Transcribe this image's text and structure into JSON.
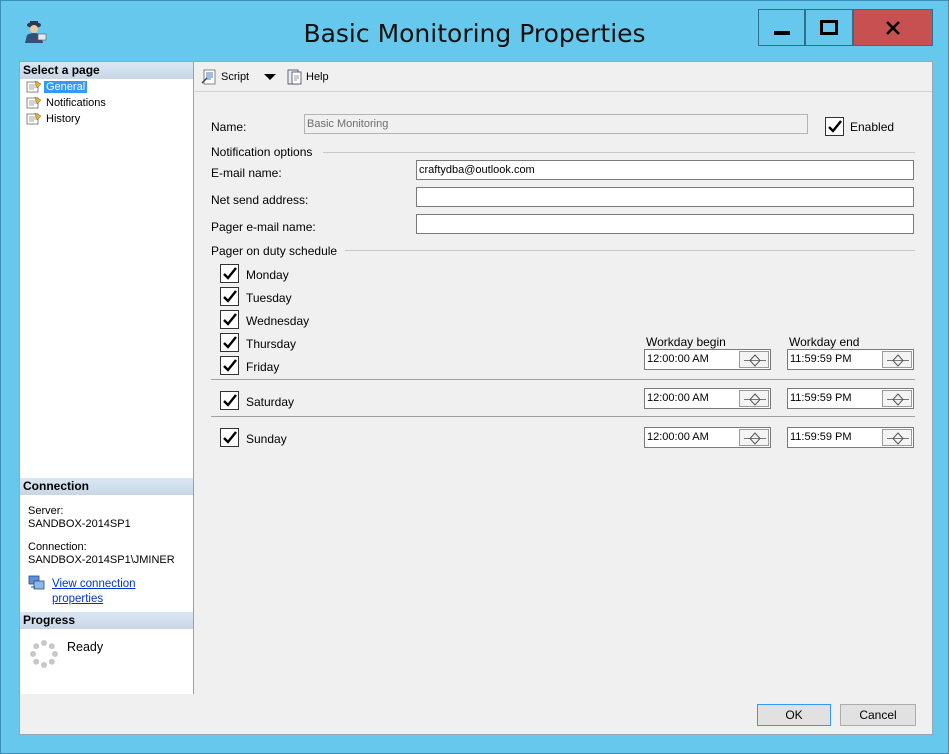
{
  "window": {
    "title": "Basic Monitoring Properties"
  },
  "left": {
    "select_page_header": "Select a page",
    "pages": [
      {
        "label": "General",
        "selected": true
      },
      {
        "label": "Notifications",
        "selected": false
      },
      {
        "label": "History",
        "selected": false
      }
    ],
    "connection_header": "Connection",
    "server_label": "Server:",
    "server_value": "SANDBOX-2014SP1",
    "connection_label": "Connection:",
    "connection_value": "SANDBOX-2014SP1\\JMINER",
    "view_link_line1": "View connection",
    "view_link_line2": "properties",
    "progress_header": "Progress",
    "progress_status": "Ready"
  },
  "toolbar": {
    "script_label": "Script",
    "help_label": "Help"
  },
  "form": {
    "name_label": "Name:",
    "name_value": "Basic Monitoring",
    "enabled_label": "Enabled",
    "enabled_checked": true,
    "notification_group": "Notification options",
    "email_label": "E-mail name:",
    "email_value": "craftydba@outlook.com",
    "netsend_label": "Net send address:",
    "netsend_value": "",
    "pager_label": "Pager e-mail name:",
    "pager_value": "",
    "schedule_group": "Pager on duty schedule",
    "days": [
      {
        "label": "Monday",
        "checked": true
      },
      {
        "label": "Tuesday",
        "checked": true
      },
      {
        "label": "Wednesday",
        "checked": true
      },
      {
        "label": "Thursday",
        "checked": true
      },
      {
        "label": "Friday",
        "checked": true
      },
      {
        "label": "Saturday",
        "checked": true
      },
      {
        "label": "Sunday",
        "checked": true
      }
    ],
    "workday_begin_label": "Workday begin",
    "workday_end_label": "Workday end",
    "weekday_begin": "12:00:00 AM",
    "weekday_end": "11:59:59 PM",
    "saturday_begin": "12:00:00 AM",
    "saturday_end": "11:59:59 PM",
    "sunday_begin": "12:00:00 AM",
    "sunday_end": "11:59:59 PM"
  },
  "buttons": {
    "ok": "OK",
    "cancel": "Cancel"
  },
  "colors": {
    "titlebar": "#66c8ec",
    "close": "#c75050",
    "selection": "#3399ff",
    "link": "#0033cc"
  }
}
